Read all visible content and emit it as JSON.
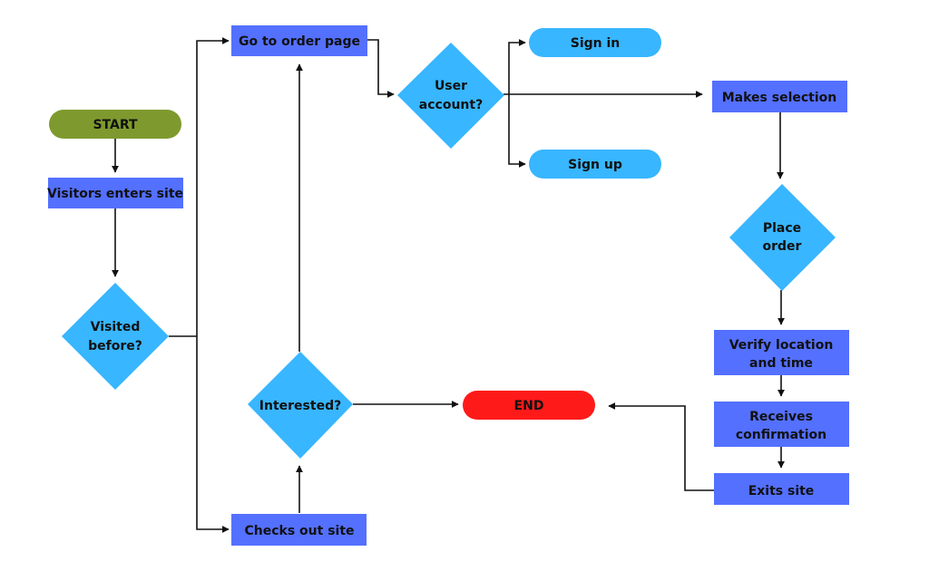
{
  "diagram": {
    "type": "flowchart",
    "colors": {
      "process": "#5470FF",
      "decision": "#38B6FF",
      "start": "#7E9A2E",
      "end": "#FF1A1A",
      "edge": "#111111"
    },
    "nodes": {
      "start": {
        "lines": [
          "START"
        ],
        "shape": "terminal"
      },
      "visitor_enters": {
        "lines": [
          "Visitors enters site"
        ],
        "shape": "process"
      },
      "visited_before": {
        "lines": [
          "Visited",
          "before?"
        ],
        "shape": "decision"
      },
      "go_to_order": {
        "lines": [
          "Go to order page"
        ],
        "shape": "process"
      },
      "checks_out": {
        "lines": [
          "Checks out site"
        ],
        "shape": "process"
      },
      "interested": {
        "lines": [
          "Interested?"
        ],
        "shape": "decision"
      },
      "user_account": {
        "lines": [
          "User",
          "account?"
        ],
        "shape": "decision"
      },
      "sign_in": {
        "lines": [
          "Sign in"
        ],
        "shape": "pill"
      },
      "sign_up": {
        "lines": [
          "Sign up"
        ],
        "shape": "pill"
      },
      "makes_selection": {
        "lines": [
          "Makes selection"
        ],
        "shape": "process"
      },
      "place_order": {
        "lines": [
          "Place",
          "order"
        ],
        "shape": "decision"
      },
      "verify": {
        "lines": [
          "Verify location",
          "and time"
        ],
        "shape": "process"
      },
      "receives": {
        "lines": [
          "Receives",
          "confirmation"
        ],
        "shape": "process"
      },
      "exits": {
        "lines": [
          "Exits site"
        ],
        "shape": "process"
      },
      "end": {
        "lines": [
          "END"
        ],
        "shape": "terminal"
      }
    },
    "edges": [
      {
        "from": "start",
        "to": "visitor_enters"
      },
      {
        "from": "visitor_enters",
        "to": "visited_before"
      },
      {
        "from": "visited_before",
        "to": "go_to_order"
      },
      {
        "from": "visited_before",
        "to": "checks_out"
      },
      {
        "from": "checks_out",
        "to": "interested"
      },
      {
        "from": "interested",
        "to": "go_to_order"
      },
      {
        "from": "interested",
        "to": "end"
      },
      {
        "from": "go_to_order",
        "to": "user_account"
      },
      {
        "from": "user_account",
        "to": "sign_in"
      },
      {
        "from": "user_account",
        "to": "sign_up"
      },
      {
        "from": "user_account",
        "to": "makes_selection"
      },
      {
        "from": "makes_selection",
        "to": "place_order"
      },
      {
        "from": "place_order",
        "to": "verify"
      },
      {
        "from": "verify",
        "to": "receives"
      },
      {
        "from": "receives",
        "to": "exits"
      },
      {
        "from": "exits",
        "to": "end"
      }
    ]
  }
}
